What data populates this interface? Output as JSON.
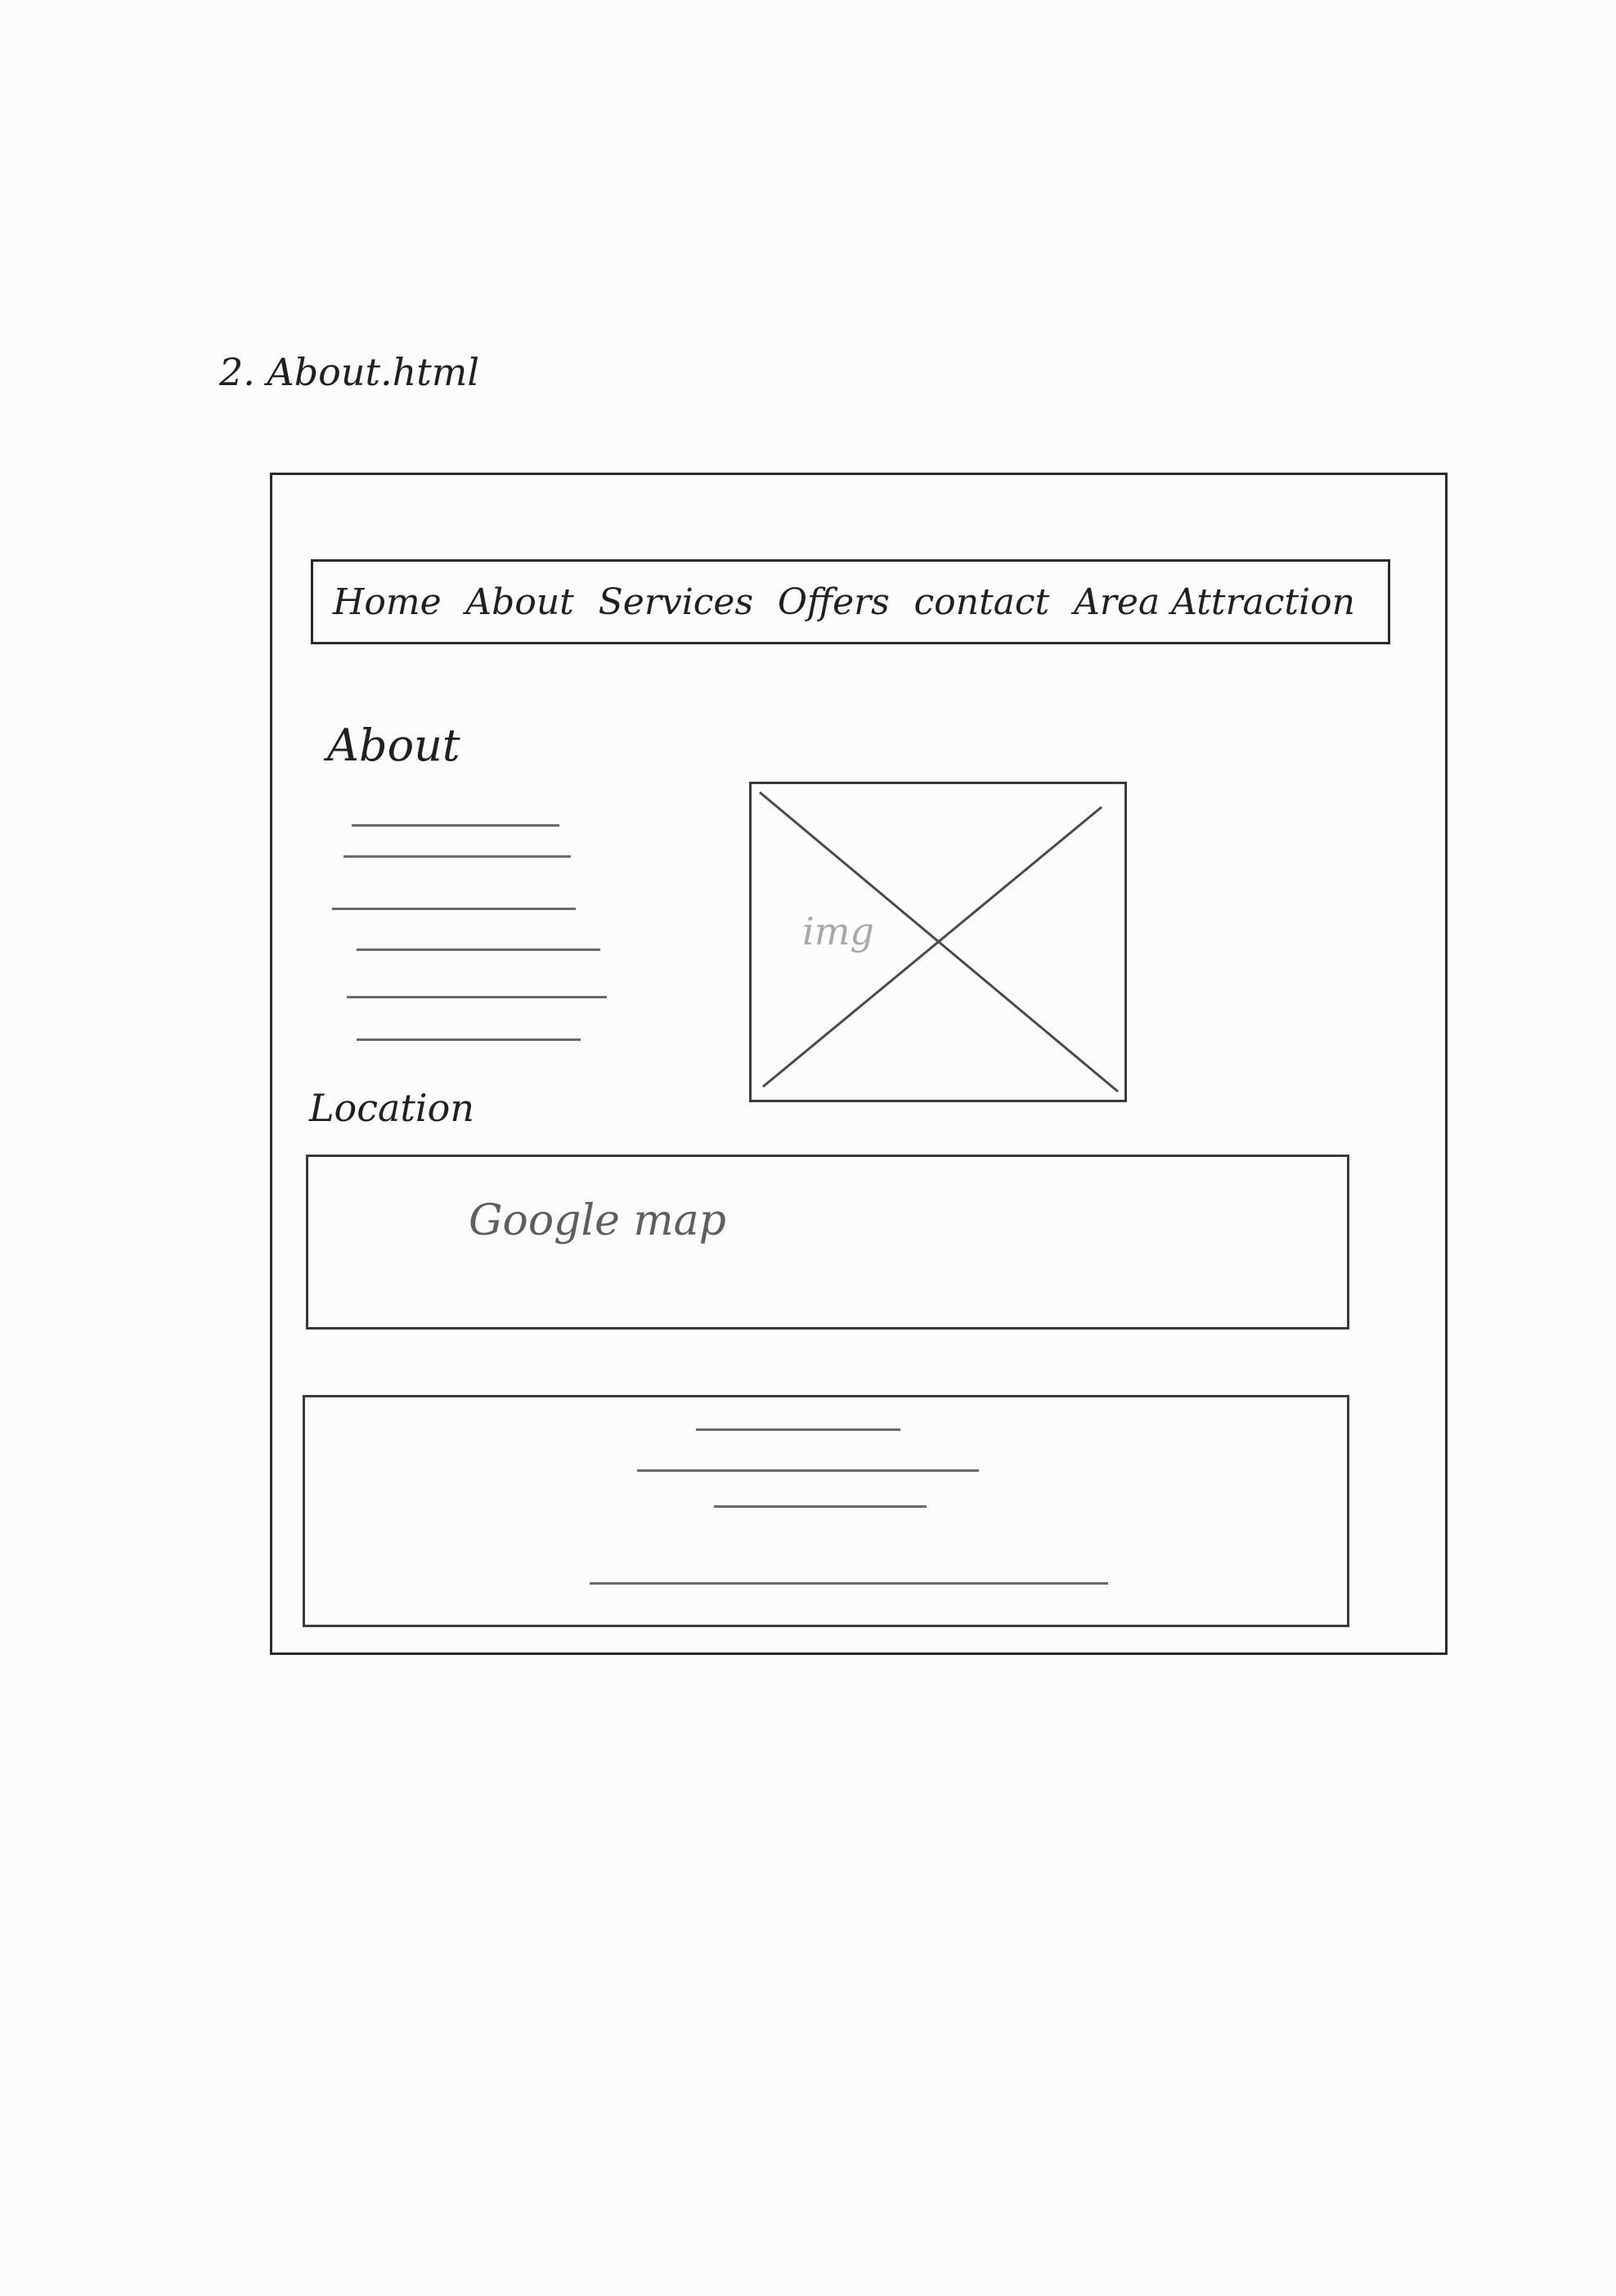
{
  "page": {
    "heading": "2. About.html"
  },
  "nav": {
    "items": [
      {
        "label": "Home"
      },
      {
        "label": "About"
      },
      {
        "label": "Services"
      },
      {
        "label": "Offers"
      },
      {
        "label": "contact"
      },
      {
        "label": "Area Attraction"
      }
    ]
  },
  "about": {
    "title": "About"
  },
  "image": {
    "label": "img"
  },
  "location": {
    "title": "Location",
    "map_label": "Google map"
  }
}
